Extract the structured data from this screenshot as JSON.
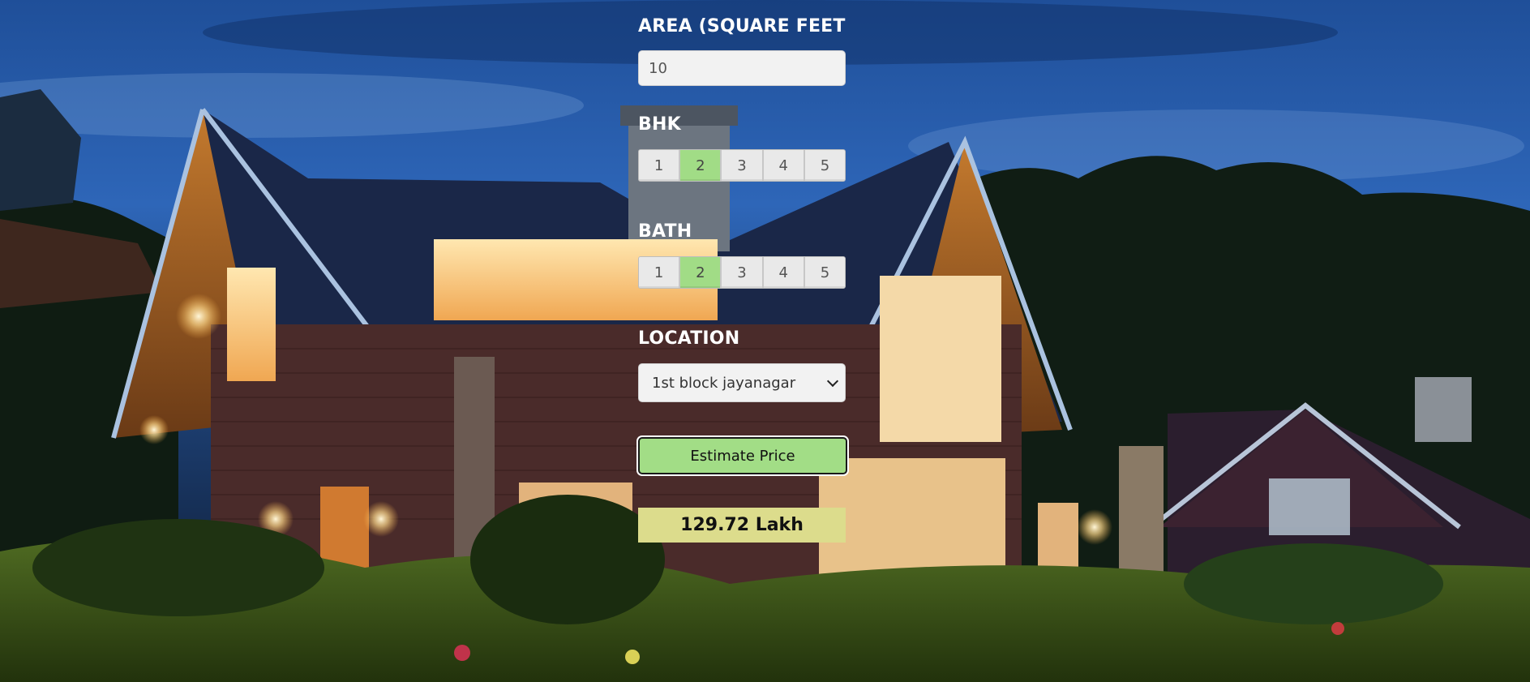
{
  "colors": {
    "accent_green": "#a1dc86",
    "result_bg": "#dcdc8c",
    "input_bg": "#f2f2f2"
  },
  "background": {
    "image": "house-at-dusk-photo"
  },
  "form": {
    "area": {
      "label": "AREA (SQUARE FEET",
      "value": "10"
    },
    "bhk": {
      "label": "BHK",
      "options": [
        "1",
        "2",
        "3",
        "4",
        "5"
      ],
      "selected": "2"
    },
    "bath": {
      "label": "BATH",
      "options": [
        "1",
        "2",
        "3",
        "4",
        "5"
      ],
      "selected": "2"
    },
    "location": {
      "label": "LOCATION",
      "selected": "1st block jayanagar",
      "icon": "chevron-down-icon"
    },
    "estimate_button": "Estimate Price",
    "result": "129.72 Lakh"
  }
}
